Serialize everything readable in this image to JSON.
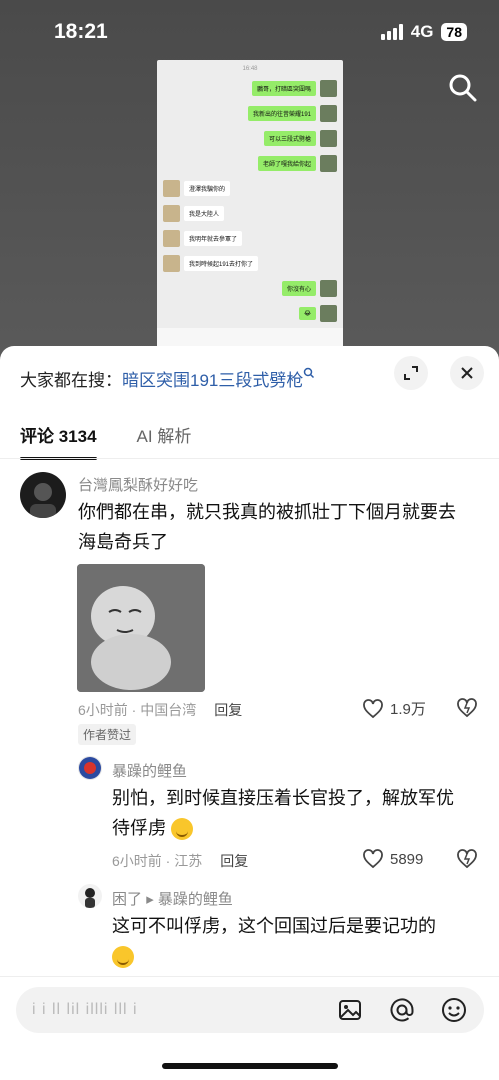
{
  "status": {
    "time": "18:21",
    "network": "4G",
    "battery": "78"
  },
  "chat_preview": {
    "time": "16:48",
    "messages": [
      {
        "side": "right",
        "text": "鵬哥，打暗區突圍嗎"
      },
      {
        "side": "right",
        "text": "我新出的往昔榮耀191"
      },
      {
        "side": "right",
        "text": "可以三段式劈槍"
      },
      {
        "side": "right",
        "text": "老師了嘎我給你起"
      },
      {
        "side": "left",
        "text": "澄澤我騙你的"
      },
      {
        "side": "left",
        "text": "我是大陸人"
      },
      {
        "side": "left",
        "text": "我明年就去參軍了"
      },
      {
        "side": "left",
        "text": "我到時候起191去打你了"
      },
      {
        "side": "right",
        "text": "你沒有心"
      },
      {
        "side": "right",
        "text": "😂"
      }
    ]
  },
  "hot_search": {
    "label": "大家都在搜：",
    "query": "暗区突围191三段式劈枪"
  },
  "tabs": {
    "comments": "评论 3134",
    "ai": "AI 解析"
  },
  "comments": [
    {
      "user": "台灣鳳梨酥好好吃",
      "text_line1": "你們都在串，就只我真的被抓壯丁下個月就要去",
      "text_line2": "海島奇兵了",
      "time_loc": "6小时前 · 中国台湾",
      "reply": "回复",
      "likes": "1.9万",
      "badge": "作者赞过"
    },
    {
      "user": "暴躁的鲤鱼",
      "text_line1": "别怕，到时候直接压着长官投了，解放军优",
      "text_line2": "待俘虏",
      "time_loc": "6小时前 · 江苏",
      "reply": "回复",
      "likes": "5899"
    },
    {
      "user": "困了",
      "reply_to": "暴躁的鲤鱼",
      "text_line1": "这可不叫俘虏，这个回国过后是要记功的"
    }
  ],
  "input": {
    "placeholder": "i i ll lil illli lll i"
  },
  "icons": [
    "search-icon",
    "minimize-icon",
    "close-icon",
    "heart-icon",
    "dislike-icon",
    "image-icon",
    "at-icon",
    "emoji-icon"
  ]
}
